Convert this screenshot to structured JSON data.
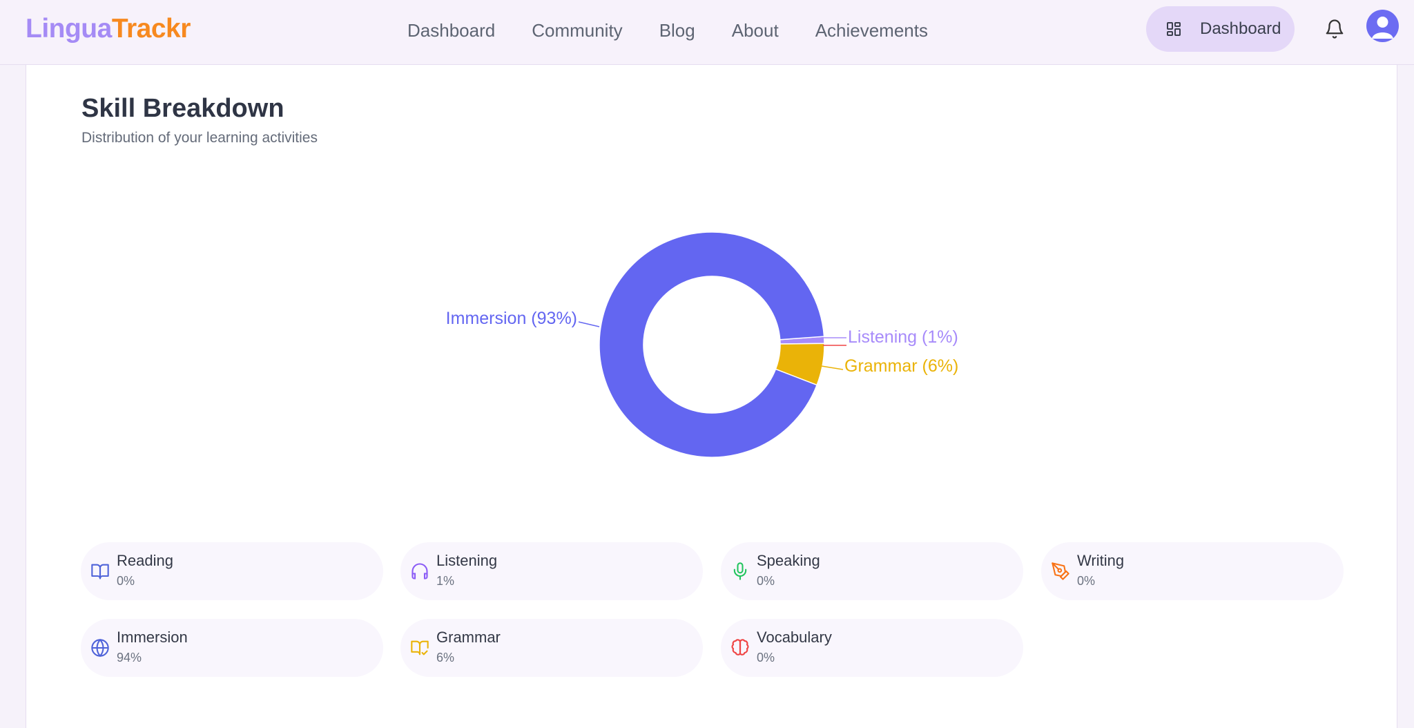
{
  "header": {
    "logo_part1": "Lingua",
    "logo_part2": "Trackr",
    "nav": [
      "Dashboard",
      "Community",
      "Blog",
      "About",
      "Achievements"
    ],
    "dashboard_button": "Dashboard"
  },
  "card": {
    "title": "Skill Breakdown",
    "subtitle": "Distribution of your learning activities"
  },
  "chart_data": {
    "type": "pie",
    "title": "",
    "slices": [
      {
        "name": "Immersion",
        "label": "Immersion (93%)",
        "value": 93,
        "color": "#6366f1"
      },
      {
        "name": "Listening",
        "label": "Listening (1%)",
        "value": 1,
        "color": "#a78bfa"
      },
      {
        "name": "Grammar",
        "label": "Grammar (6%)",
        "value": 6,
        "color": "#eab308"
      }
    ]
  },
  "stats": [
    {
      "name": "Reading",
      "value": "0%",
      "icon": "book-icon",
      "color": "#4f63d9"
    },
    {
      "name": "Listening",
      "value": "1%",
      "icon": "headphones-icon",
      "color": "#8b5cf6"
    },
    {
      "name": "Speaking",
      "value": "0%",
      "icon": "microphone-icon",
      "color": "#22c55e"
    },
    {
      "name": "Writing",
      "value": "0%",
      "icon": "pen-icon",
      "color": "#f97316"
    },
    {
      "name": "Immersion",
      "value": "94%",
      "icon": "globe-icon",
      "color": "#4f63d9"
    },
    {
      "name": "Grammar",
      "value": "6%",
      "icon": "grammar-book-icon",
      "color": "#eab308"
    },
    {
      "name": "Vocabulary",
      "value": "0%",
      "icon": "brain-icon",
      "color": "#ef4444"
    }
  ]
}
